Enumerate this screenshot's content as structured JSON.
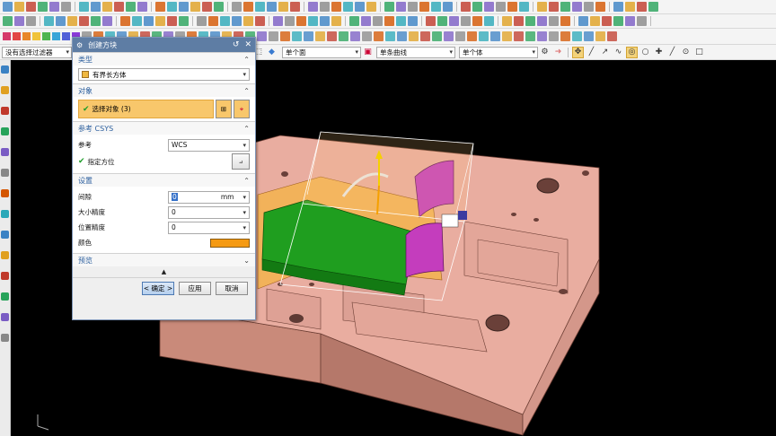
{
  "toolbar": {
    "filter_dropdown": "没有选择过滤器",
    "face_rule": "单个面",
    "curve_rule": "单条曲线",
    "body_rule": "单个体",
    "swatch_colors": [
      "#d63a6b",
      "#e24646",
      "#e8872a",
      "#f0c33a",
      "#4fb54f",
      "#3aa6d8",
      "#5060d8",
      "#8a3ad8"
    ]
  },
  "dialog": {
    "title": "创建方块",
    "reset_icon": "reset-icon",
    "close_icon": "close-icon",
    "type_section": {
      "header": "类型",
      "value": "有界长方体"
    },
    "object_section": {
      "header": "对象",
      "select_label": "选择对象 (3)"
    },
    "csys_section": {
      "header": "参考 CSYS",
      "ref_label": "参考",
      "ref_value": "WCS",
      "orient_label": "指定方位"
    },
    "settings_section": {
      "header": "设置",
      "gap_label": "间隙",
      "gap_value": "0",
      "gap_unit": "mm",
      "size_precision_label": "大小精度",
      "size_precision_value": "0",
      "pos_precision_label": "位置精度",
      "pos_precision_value": "0",
      "color_label": "颜色",
      "color_value": "#f59a12"
    },
    "preview_section": {
      "header": "预览"
    },
    "buttons": {
      "ok": "< 确定 >",
      "apply": "应用",
      "cancel": "取消"
    }
  }
}
